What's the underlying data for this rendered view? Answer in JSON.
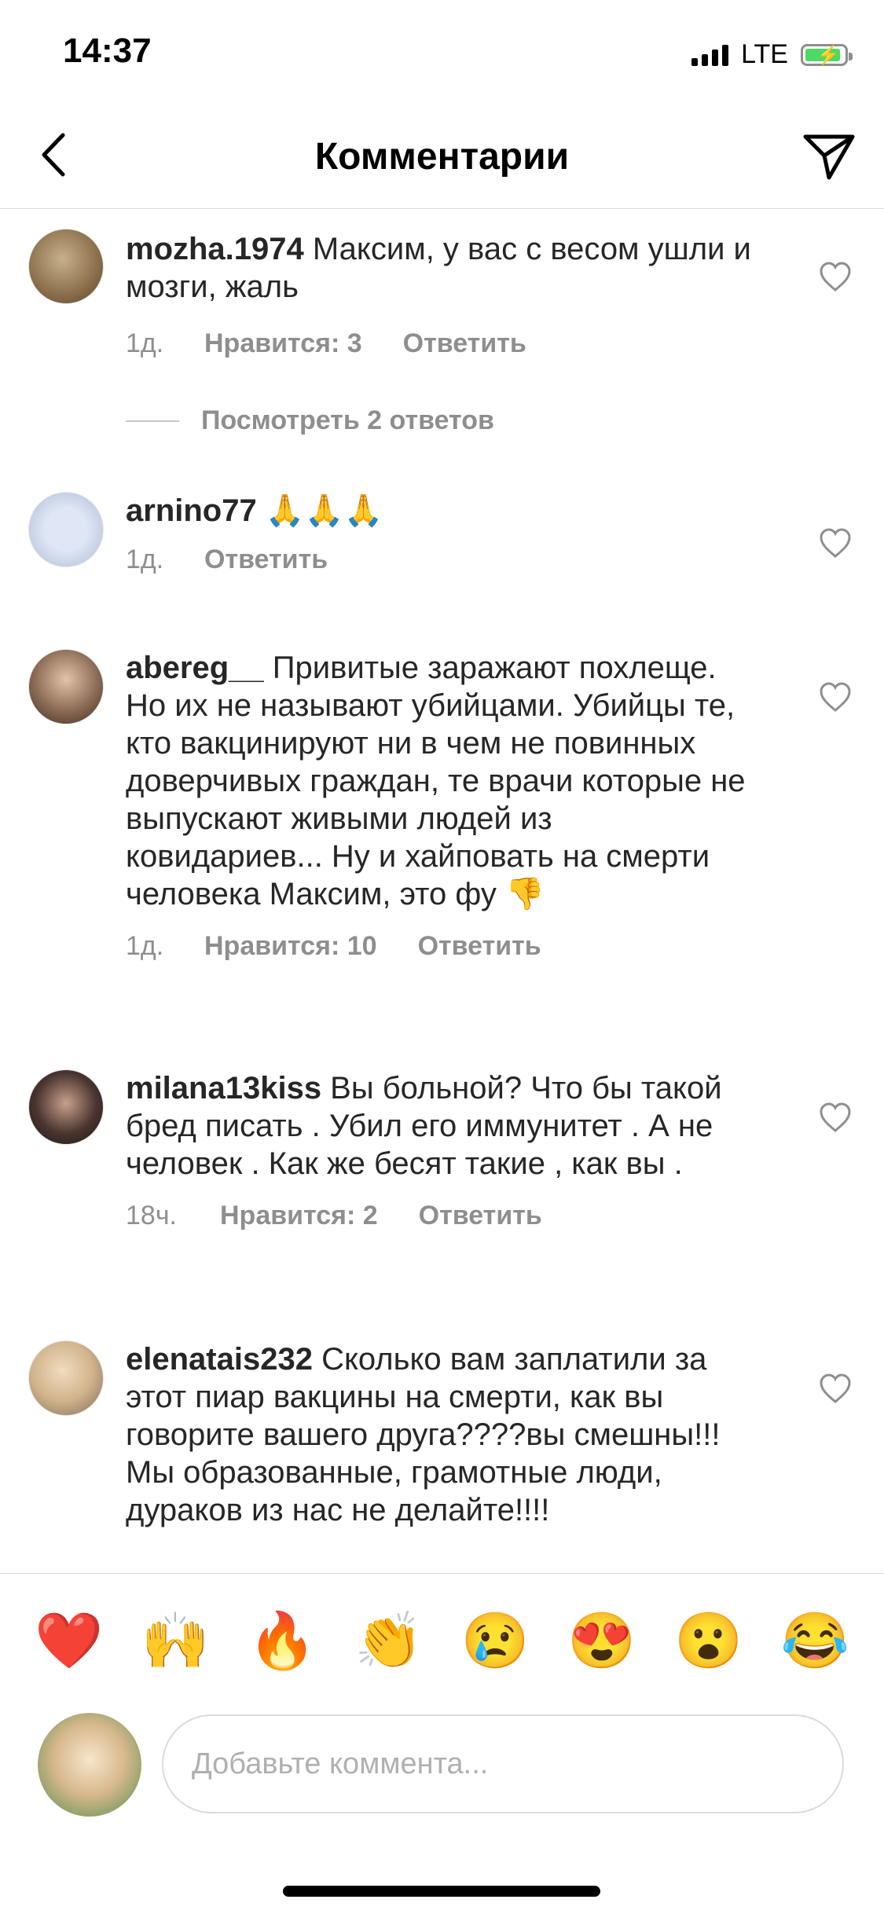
{
  "status": {
    "time": "14:37",
    "network": "LTE"
  },
  "nav": {
    "title": "Комментарии"
  },
  "comments": [
    {
      "user": "mozha.1974",
      "text": " Максим, у вас с весом ушли и мозги, жаль",
      "time": "1д.",
      "likes": "Нравится: 3",
      "reply": "Ответить",
      "view_replies": "Посмотреть 2 ответов"
    },
    {
      "user": "arnino77",
      "text": " 🙏🙏🙏",
      "time": "1д.",
      "reply": "Ответить"
    },
    {
      "user": "abereg__",
      "text": " Привитые заражают похлеще. Но их не называют убийцами. Убийцы те, кто вакцинируют ни в чем не повинных доверчивых граждан, те врачи которые не выпускают живыми людей из ковидариев... Ну и хайповать на смерти человека Максим, это фу 👎",
      "time": "1д.",
      "likes": "Нравится: 10",
      "reply": "Ответить"
    },
    {
      "user": "milana13kiss",
      "text": " Вы больной? Что бы такой бред писать . Убил его иммунитет . А не человек . Как же бесят такие , как вы .",
      "time": "18ч.",
      "likes": "Нравится: 2",
      "reply": "Ответить"
    },
    {
      "user": "elenatais232",
      "text": " Сколько вам заплатили за этот пиар вакцины  на смерти, как вы говорите  вашего друга????вы смешны!!! Мы образованные, грамотные люди, дураков  из нас не делайте!!!!"
    }
  ],
  "emoji_bar": [
    "❤️",
    "🙌",
    "🔥",
    "👏",
    "😢",
    "😍",
    "😮",
    "😂"
  ],
  "input": {
    "placeholder": "Добавьте коммента..."
  }
}
